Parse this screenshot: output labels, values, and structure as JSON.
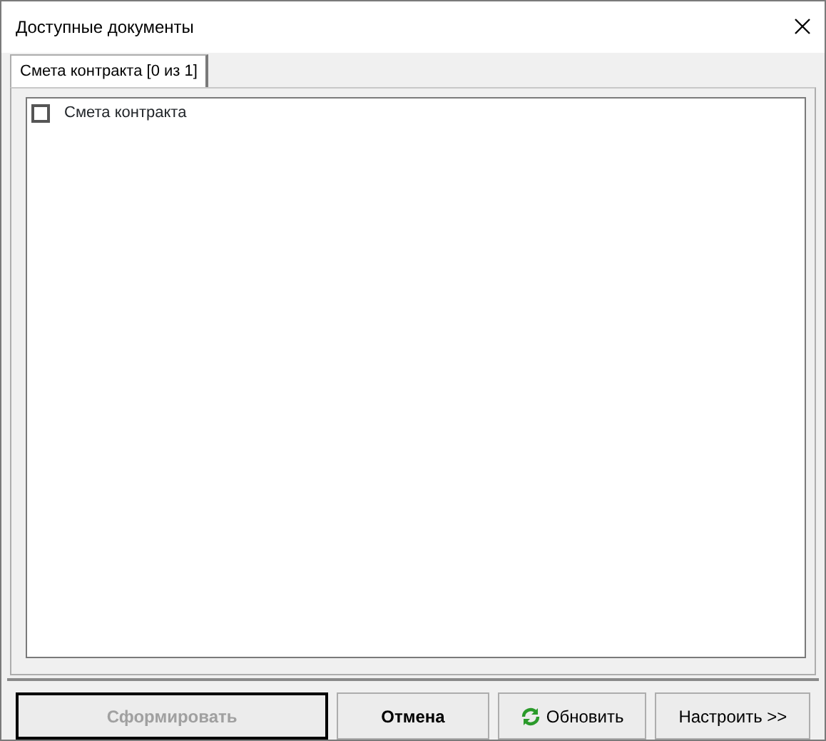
{
  "window": {
    "title": "Доступные документы"
  },
  "tabs": [
    {
      "label": "Смета контракта [0 из 1]",
      "selected": true
    }
  ],
  "items": [
    {
      "label": "Смета контракта",
      "checked": false
    }
  ],
  "buttons": [
    {
      "label": "Сформировать",
      "kind": "default",
      "disabled": true
    },
    {
      "label": "Отмена",
      "kind": "bold",
      "disabled": false
    },
    {
      "label": "Обновить",
      "kind": "refresh",
      "disabled": false
    },
    {
      "label": "Настроить >>",
      "kind": "plain",
      "disabled": false
    }
  ]
}
